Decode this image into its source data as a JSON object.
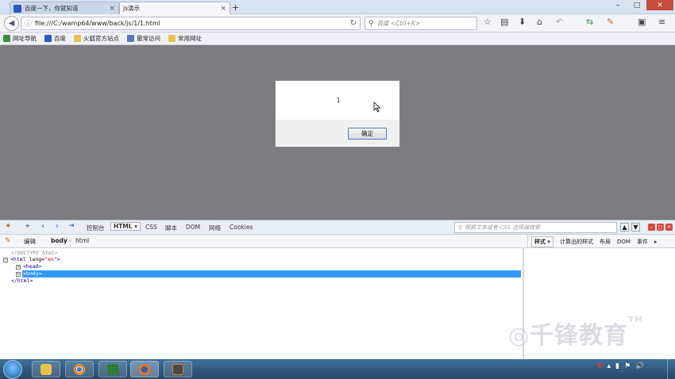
{
  "tabs": [
    {
      "title": "百度一下，你就知道",
      "close": "×"
    },
    {
      "title": "js演示",
      "close": "×"
    }
  ],
  "newtab": "+",
  "window_controls": {
    "minimize": "–",
    "maximize": "□",
    "close": "✕"
  },
  "navbar": {
    "url": "file:///C:/wamp64/www/back/js/1/1.html",
    "search_placeholder": "百度 <Ctrl+K>",
    "icons": [
      "star-icon",
      "reader-icon",
      "download-icon",
      "home-icon",
      "undo-icon",
      "sync-icon",
      "addon-icon",
      "screenshot-icon",
      "menu-icon"
    ]
  },
  "bookmarks": [
    {
      "label": "网址导航",
      "color": "#3a8f3a"
    },
    {
      "label": "百度",
      "color": "#2a57c5"
    },
    {
      "label": "火狐官方站点",
      "color": "#e8c34a"
    },
    {
      "label": "最常访问",
      "color": "#5a7ab8"
    },
    {
      "label": "常用网址",
      "color": "#e8c34a"
    }
  ],
  "dialog": {
    "message": "1",
    "ok_label": "确定"
  },
  "firebug": {
    "tabs": [
      "控制台",
      "HTML ▾",
      "CSS",
      "脚本",
      "DOM",
      "网络",
      "Cookies"
    ],
    "search_placeholder": "根据文本或者 CSS 选择器搜索",
    "sub": {
      "edit_label": "编辑",
      "crumb_body": "body",
      "crumb_sep": "‹",
      "crumb_html": "html"
    },
    "side_tabs": [
      "样式 ▾",
      "计算出的样式",
      "布局",
      "DOM",
      "事件"
    ],
    "tree": {
      "doctype": "<!DOCTYPE html>",
      "html_open_tag": "<html",
      "html_attr": "lang=",
      "html_attr_value": "\"en\"",
      "html_close_bracket": ">",
      "head": "<head>",
      "body": "<body>",
      "html_close": "</html>"
    }
  },
  "watermark": {
    "text": "千锋教育",
    "tm": "TM"
  },
  "taskbar": {
    "apps": [
      "explorer",
      "chrome",
      "excel",
      "firefox",
      "sublime"
    ],
    "tray": {
      "ime": "S",
      "volume": "🔊"
    }
  },
  "colors": {
    "selection": "#3399ff",
    "overlay": "#7b7b80",
    "taskbar": "#2f5a82"
  }
}
